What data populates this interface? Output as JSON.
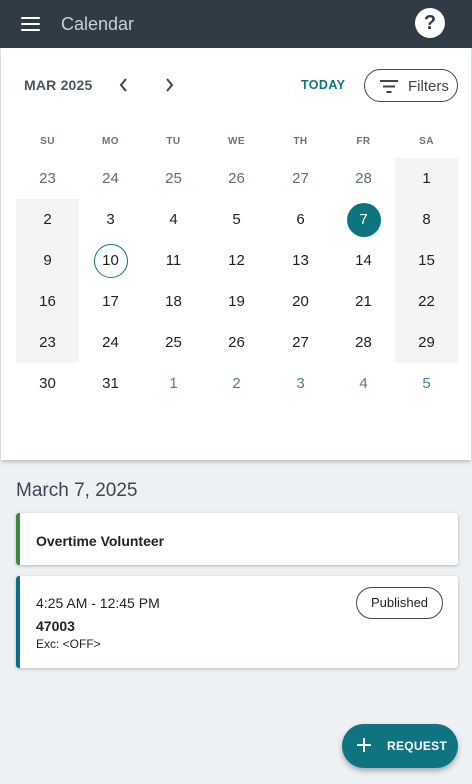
{
  "header": {
    "title": "Calendar",
    "help_label": "?"
  },
  "calendar": {
    "month_label": "MAR 2025",
    "today_label": "TODAY",
    "filters_label": "Filters",
    "weekdays": [
      "SU",
      "MO",
      "TU",
      "WE",
      "TH",
      "FR",
      "SA"
    ],
    "weeks": [
      [
        "23",
        "24",
        "25",
        "26",
        "27",
        "28",
        "1"
      ],
      [
        "2",
        "3",
        "4",
        "5",
        "6",
        "7",
        "8"
      ],
      [
        "9",
        "10",
        "11",
        "12",
        "13",
        "14",
        "15"
      ],
      [
        "16",
        "17",
        "18",
        "19",
        "20",
        "21",
        "22"
      ],
      [
        "23",
        "24",
        "25",
        "26",
        "27",
        "28",
        "29"
      ],
      [
        "30",
        "31",
        "1",
        "2",
        "3",
        "4",
        "5"
      ]
    ],
    "selected_day": "7",
    "today_day": "10",
    "accent_color": "#0d7480"
  },
  "agenda": {
    "date_heading": "March 7, 2025",
    "items": [
      {
        "title": "Overtime Volunteer",
        "bar_color": "#3f8a3a"
      },
      {
        "time": "4:25 AM - 12:45 PM",
        "code": "47003",
        "exception": "Exc: <OFF>",
        "status": "Published",
        "bar_color": "#0d6e8a"
      }
    ]
  },
  "fab": {
    "label": "REQUEST",
    "icon": "plus-icon"
  },
  "icons": {
    "menu": "hamburger-menu-icon",
    "prev": "chevron-left-icon",
    "next": "chevron-right-icon",
    "filter": "filter-icon",
    "help": "help-icon"
  }
}
